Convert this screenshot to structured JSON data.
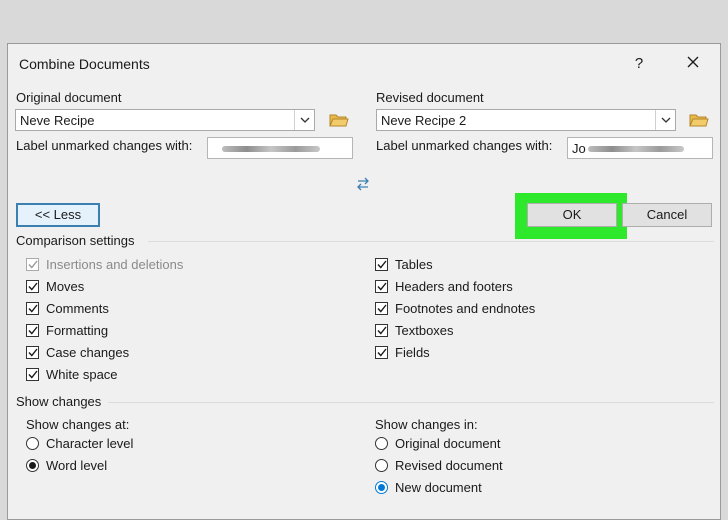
{
  "dialog": {
    "title": "Combine Documents",
    "help_label": "?",
    "close_label": "✕"
  },
  "original": {
    "heading": "Original document",
    "selected": "Neve Recipe",
    "label_text": "Label unmarked changes with:"
  },
  "revised": {
    "heading": "Revised document",
    "selected": "Neve Recipe 2",
    "label_text": "Label unmarked changes with:",
    "label_value_prefix": "Jo"
  },
  "buttons": {
    "less": "<< Less",
    "ok": "OK",
    "cancel": "Cancel"
  },
  "comparison": {
    "heading": "Comparison settings",
    "left": [
      {
        "label": "Insertions and deletions",
        "checked": true,
        "disabled": true
      },
      {
        "label": "Moves",
        "checked": true,
        "disabled": false
      },
      {
        "label": "Comments",
        "checked": true,
        "disabled": false
      },
      {
        "label": "Formatting",
        "checked": true,
        "disabled": false
      },
      {
        "label": "Case changes",
        "checked": true,
        "disabled": false
      },
      {
        "label": "White space",
        "checked": true,
        "disabled": false
      }
    ],
    "right": [
      {
        "label": "Tables",
        "checked": true
      },
      {
        "label": "Headers and footers",
        "checked": true
      },
      {
        "label": "Footnotes and endnotes",
        "checked": true
      },
      {
        "label": "Textboxes",
        "checked": true
      },
      {
        "label": "Fields",
        "checked": true
      }
    ]
  },
  "show_changes": {
    "heading": "Show changes",
    "at_heading": "Show changes at:",
    "at_options": [
      {
        "label": "Character level",
        "selected": false
      },
      {
        "label": "Word level",
        "selected": true
      }
    ],
    "in_heading": "Show changes in:",
    "in_options": [
      {
        "label": "Original document",
        "selected": false
      },
      {
        "label": "Revised document",
        "selected": false
      },
      {
        "label": "New document",
        "selected": true
      }
    ]
  },
  "colors": {
    "ok_highlight": "#2ee82b",
    "accent": "#0078d7"
  }
}
